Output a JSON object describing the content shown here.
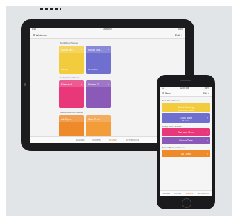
{
  "tablet": {
    "status": {
      "left": "iPad",
      "center": "12:00 PM",
      "right": "100%"
    },
    "nav": {
      "left_label": "Welcome",
      "right_label": "Edit"
    },
    "sections": [
      {
        "title": "Multi Room Scenes",
        "tiles": [
          {
            "label": "Good Mo...",
            "sub": "Kitchen",
            "color": "#f2cc3c"
          },
          {
            "label": "Good Nig...",
            "sub": "All Rooms",
            "color": "#6f6fd0"
          }
        ]
      },
      {
        "title": "Living Room Scenes",
        "tiles": [
          {
            "label": "Rise and...",
            "sub": "",
            "color": "#e8387a"
          },
          {
            "label": "Dinner Ti...",
            "sub": "",
            "color": "#8b59b8"
          }
        ]
      },
      {
        "title": "Master Bedroom Scenes",
        "tiles": [
          {
            "label": "All Open",
            "sub": "",
            "color": "#ef8a2b"
          },
          {
            "label": "Nap Time",
            "sub": "",
            "color": "#f39c3a"
          }
        ]
      }
    ],
    "tabs": [
      "SHADES",
      "ROOMS",
      "SCENES",
      "AUTOMATION"
    ],
    "active_tab": 2
  },
  "phone": {
    "status": {
      "left": "•••",
      "center": "12:00 PM",
      "right": "100%"
    },
    "nav": {
      "left_label": "Menu",
      "right_label": "Edit"
    },
    "sections": [
      {
        "title": "Multi Room Scenes",
        "bars": [
          {
            "label": "Good Morning",
            "sub": "Living Room, Kitchen",
            "color": "#f2cc3c"
          },
          {
            "label": "Good Night",
            "sub": "All Rooms",
            "color": "#6f6fd0"
          }
        ]
      },
      {
        "title": "Living Room Scenes",
        "bars": [
          {
            "label": "Rise and Shine",
            "sub": "",
            "color": "#e8387a"
          },
          {
            "label": "Dinner Time",
            "sub": "",
            "color": "#8b59b8"
          }
        ]
      },
      {
        "title": "Master Bedroom Scenes",
        "bars": [
          {
            "label": "All Open",
            "sub": "",
            "color": "#ef8a2b"
          }
        ]
      }
    ],
    "tabs": [
      "SHADES",
      "ROOMS",
      "SCENES",
      "AUTOMATION"
    ],
    "active_tab": 2
  }
}
